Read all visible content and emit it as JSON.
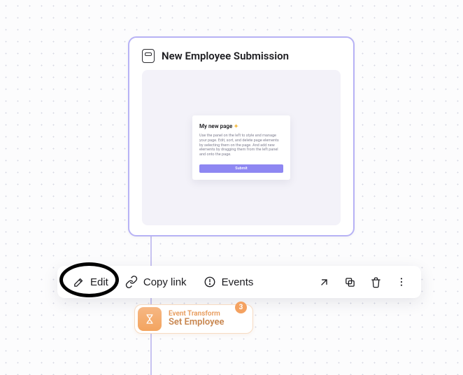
{
  "card": {
    "title": "New Employee Submission",
    "mock": {
      "title": "My new page",
      "body": "Use the panel on the left to style and manage your page. Edit, sort, and delete page elements by selecting them on the page. And add new elements by dragging them from the left panel and onto the page.",
      "submit": "Submit"
    }
  },
  "toolbar": {
    "edit": "Edit",
    "copy": "Copy link",
    "events": "Events"
  },
  "transform": {
    "kicker": "Event Transform",
    "name": "Set Employee",
    "count": "3"
  }
}
